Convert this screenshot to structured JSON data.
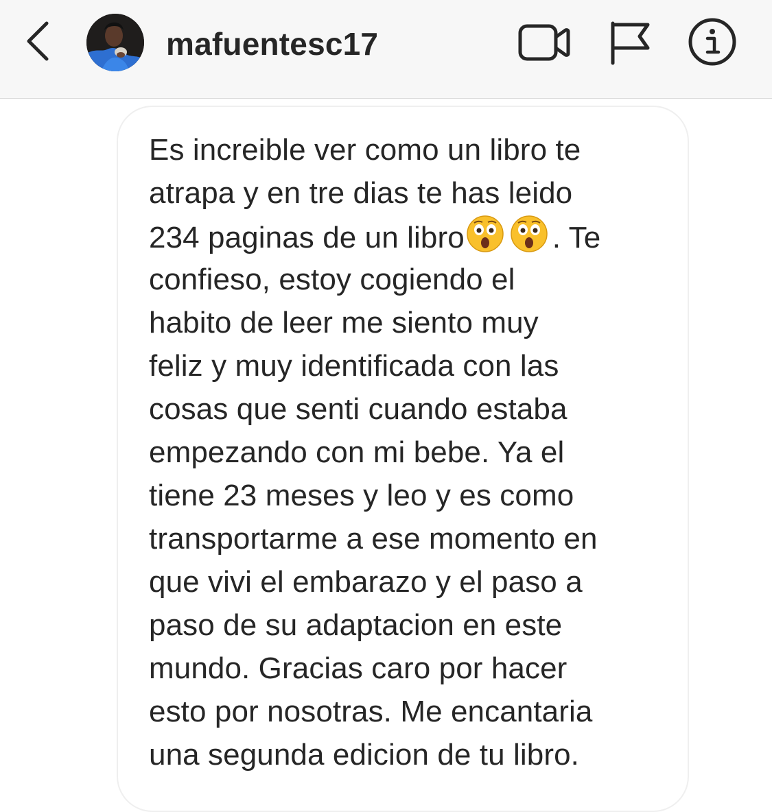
{
  "header": {
    "username": "mafuentesc17"
  },
  "message": {
    "lines": [
      "Es increible ver como un libro te",
      "atrapa y en tre dias te has leido",
      "234 paginas de un libro",
      "confieso, estoy cogiendo el",
      "habito de leer me siento muy",
      "feliz y muy identificada con las",
      "cosas que senti cuando estaba",
      "empezando con mi bebe. Ya el",
      "tiene 23 meses y leo y es como",
      "transportarme a ese momento en",
      "que vivi el embarazo y el paso a",
      "paso de su adaptacion en este",
      "mundo. Gracias caro por hacer",
      "esto por nosotras. Me encantaria",
      "una segunda edicion de tu libro."
    ],
    "line3_tail": ". Te",
    "emoji": "astonished-face",
    "emoji_count": 2
  },
  "icons": {
    "back": "chevron-left-icon",
    "video": "video-camera-icon",
    "flag": "flag-icon",
    "info": "info-icon"
  },
  "colors": {
    "header_bg": "#f7f7f7",
    "text": "#262626",
    "bubble_border": "#efefef",
    "emoji_face": "#f9c02b"
  }
}
